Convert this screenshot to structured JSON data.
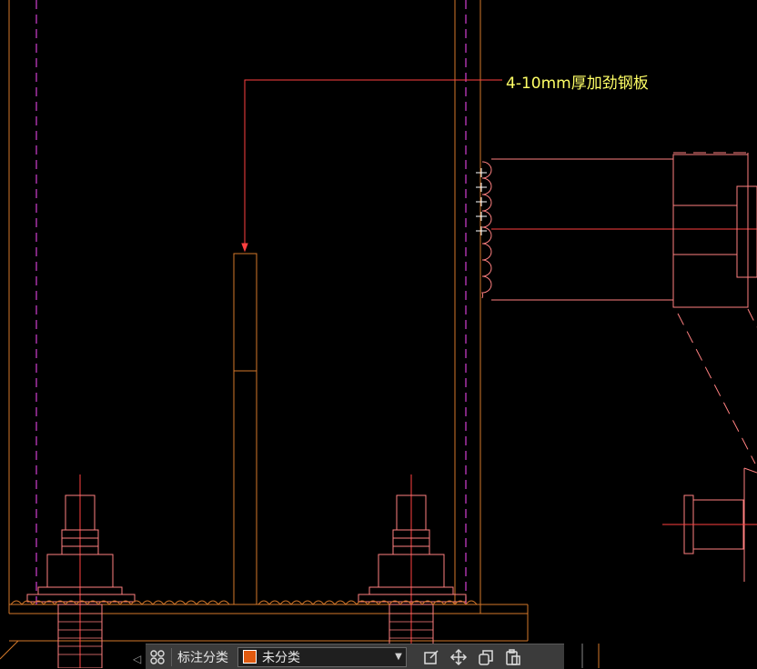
{
  "drawing": {
    "annotation_text": "4-10mm厚加劲钢板",
    "colors": {
      "frame": "#d4782a",
      "dashed_magenta": "#d040d0",
      "leader": "#ff4040",
      "annotation": "#ffff66",
      "bolt": "#ff8080",
      "weld": "#ffffff",
      "stiffener": "#d4782a"
    }
  },
  "toolbar": {
    "left_arrow_icon": "◁",
    "category_icon": "grid-icon",
    "category_label": "标注分类",
    "select_value": "未分类",
    "swatch_color": "#e05a10",
    "tools": [
      "edit-icon",
      "move-icon",
      "copy-icon",
      "paste-icon"
    ]
  }
}
